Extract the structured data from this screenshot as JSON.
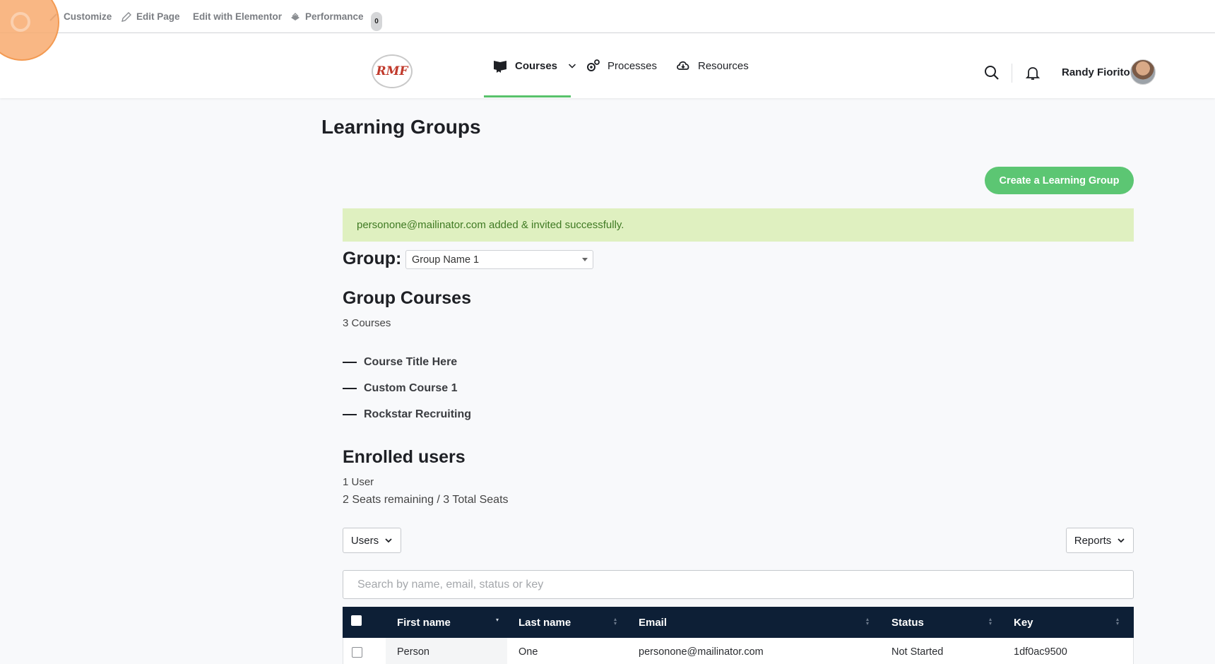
{
  "admin_bar": {
    "items": [
      {
        "label": "Customize",
        "icon": "brush-icon"
      },
      {
        "label": "Edit Page",
        "icon": "pencil-icon"
      },
      {
        "label": "Edit with Elementor",
        "icon": ""
      },
      {
        "label": "Performance",
        "icon": "performance-icon"
      }
    ],
    "badge": "0"
  },
  "header": {
    "logo_text": "RMF",
    "nav": [
      {
        "label": "Courses",
        "icon": "courses-icon",
        "active": true
      },
      {
        "label": "Processes",
        "icon": "gears-icon"
      },
      {
        "label": "Resources",
        "icon": "cloud-download-icon"
      }
    ],
    "user_name": "Randy Fiorito",
    "accent_color": "#58c26b"
  },
  "page": {
    "title": "Learning Groups",
    "create_button": "Create a Learning Group",
    "alert": "personone@mailinator.com added & invited successfully.",
    "group_label": "Group:",
    "group_selected": "Group Name 1",
    "courses_heading": "Group Courses",
    "courses_count": "3 Courses",
    "courses": [
      "Course Title Here",
      "Custom Course 1",
      "Rockstar Recruiting"
    ],
    "enrolled_heading": "Enrolled users",
    "user_count": "1 User",
    "seats": "2 Seats remaining / 3 Total Seats",
    "users_button": "Users",
    "reports_button": "Reports",
    "search_placeholder": "Search by name, email, status or key"
  },
  "table": {
    "columns": [
      "First name",
      "Last name",
      "Email",
      "Status",
      "Key"
    ],
    "rows": [
      {
        "first": "Person",
        "last": "One",
        "email": "personone@mailinator.com",
        "status": "Not Started",
        "key": "1df0ac9500"
      }
    ]
  }
}
